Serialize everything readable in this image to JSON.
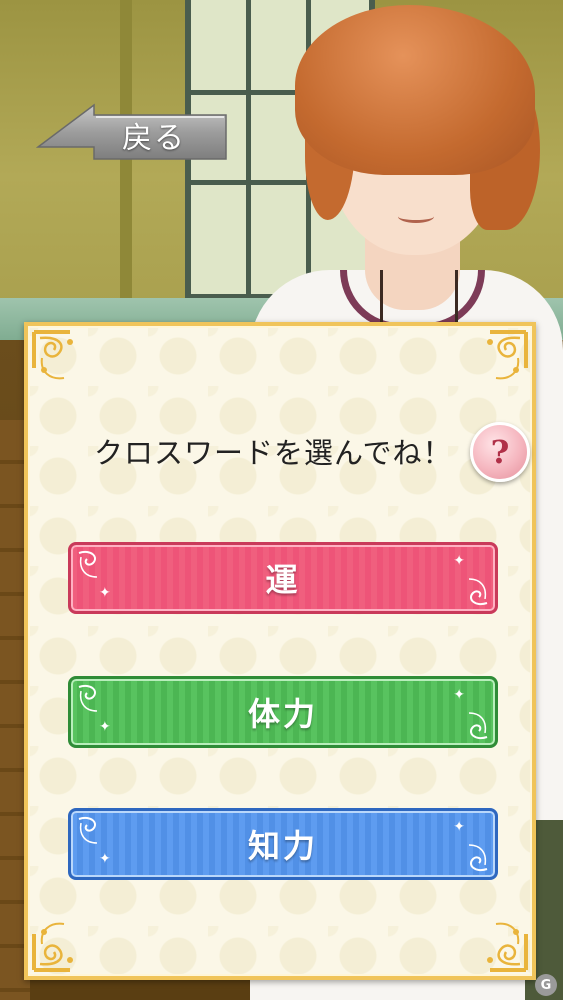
{
  "header": {
    "back_label": "戻る"
  },
  "dialog": {
    "prompt": "クロスワードを選んでね！",
    "help_label": "?",
    "choices": [
      {
        "label": "運",
        "color": "#ee5478"
      },
      {
        "label": "体力",
        "color": "#4cb653"
      },
      {
        "label": "知力",
        "color": "#5190e6"
      }
    ]
  },
  "icons": {
    "back": "arrow-left-icon",
    "help": "question-icon",
    "watermark": "gamer-logo-icon"
  },
  "colors": {
    "frame_gold": "#f0c45a",
    "panel_bg": "#fbf7e7"
  }
}
